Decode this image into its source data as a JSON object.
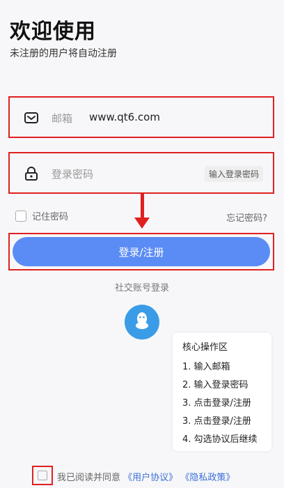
{
  "header": {
    "title": "欢迎使用",
    "subtitle": "未注册的用户将自动注册"
  },
  "email": {
    "label": "邮箱",
    "value": "www.qt6.com",
    "icon": "mail-icon"
  },
  "password": {
    "placeholder": "登录密码",
    "hint": "输入登录密码",
    "icon": "lock-icon"
  },
  "remember": {
    "label": "记住密码",
    "checked": false
  },
  "forgot": "忘记密码?",
  "login_button": "登录/注册",
  "social": {
    "label": "社交账号登录",
    "icon": "qq-icon",
    "color": "#3a9ce6"
  },
  "core_panel": {
    "title": "核心操作区",
    "steps": [
      "1. 输入邮箱",
      "2. 输入登录密码",
      "3. 点击登录/注册",
      "3. 点击登录/注册",
      "4. 勾选协议后继续"
    ]
  },
  "agreement": {
    "prefix": "我已阅读并同意",
    "user_agreement": "《用户协议》",
    "privacy_policy": "《隐私政策》",
    "checked": false
  },
  "colors": {
    "accent": "#5b8cf5",
    "annotation": "#e02020",
    "link": "#3a6fd8"
  }
}
